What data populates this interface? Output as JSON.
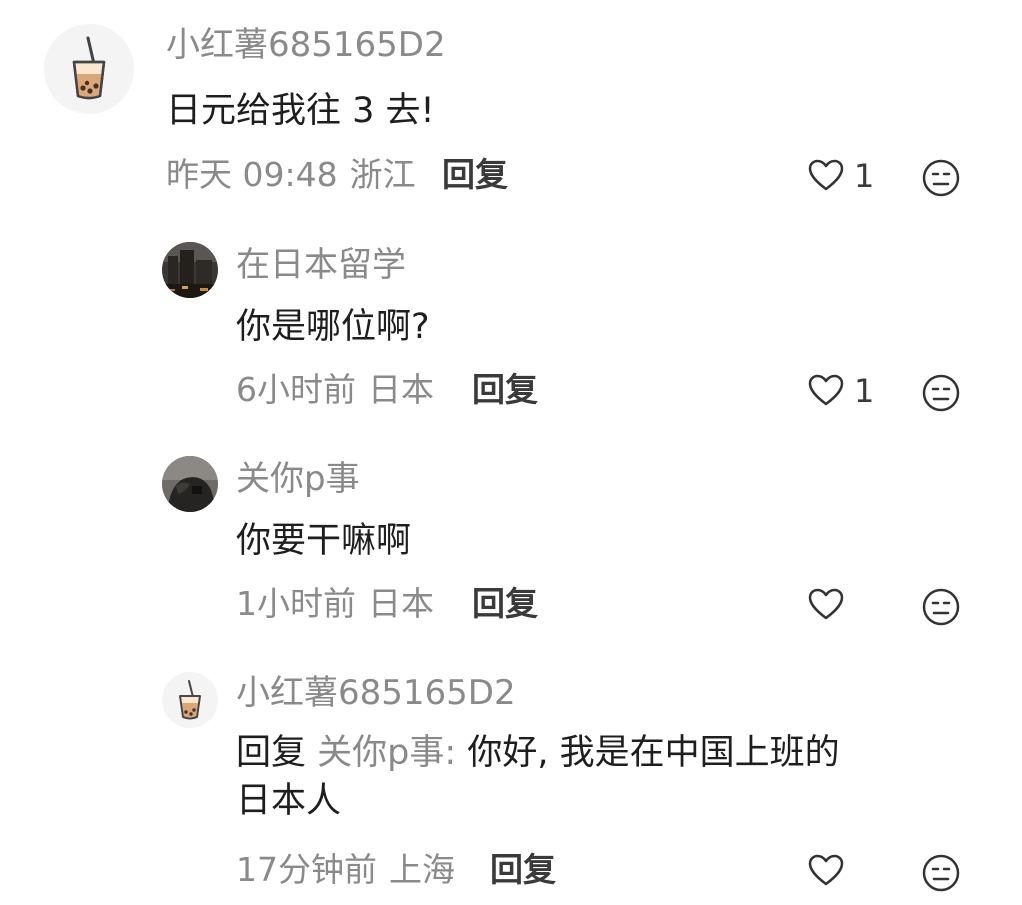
{
  "comments": [
    {
      "username": "小红薯685165D2",
      "content": "日元给我往 3 去!",
      "time": "昨天 09:48",
      "location": "浙江",
      "reply_label": "回复",
      "like_count": "1",
      "avatar_icon": "bubble-tea-icon"
    },
    {
      "username": "在日本留学",
      "content": "你是哪位啊?",
      "time": "6小时前",
      "location": "日本",
      "reply_label": "回复",
      "like_count": "1",
      "avatar_icon": "city-night-photo"
    },
    {
      "username": "关你p事",
      "content": "你要干嘛啊",
      "time": "1小时前",
      "location": "日本",
      "reply_label": "回复",
      "like_count": "",
      "avatar_icon": "dark-photo"
    },
    {
      "username": "小红薯685165D2",
      "reply_prefix": "回复",
      "reply_target": "关你p事:",
      "content_line1": "你好, 我是在中国上班的",
      "content_line2": "日本人",
      "time": "17分钟前",
      "location": "上海",
      "reply_label": "回复",
      "like_count": "",
      "avatar_icon": "bubble-tea-icon"
    }
  ],
  "colors": {
    "meta_gray": "#8a8a8a",
    "text_dark": "#1e1e1e"
  }
}
